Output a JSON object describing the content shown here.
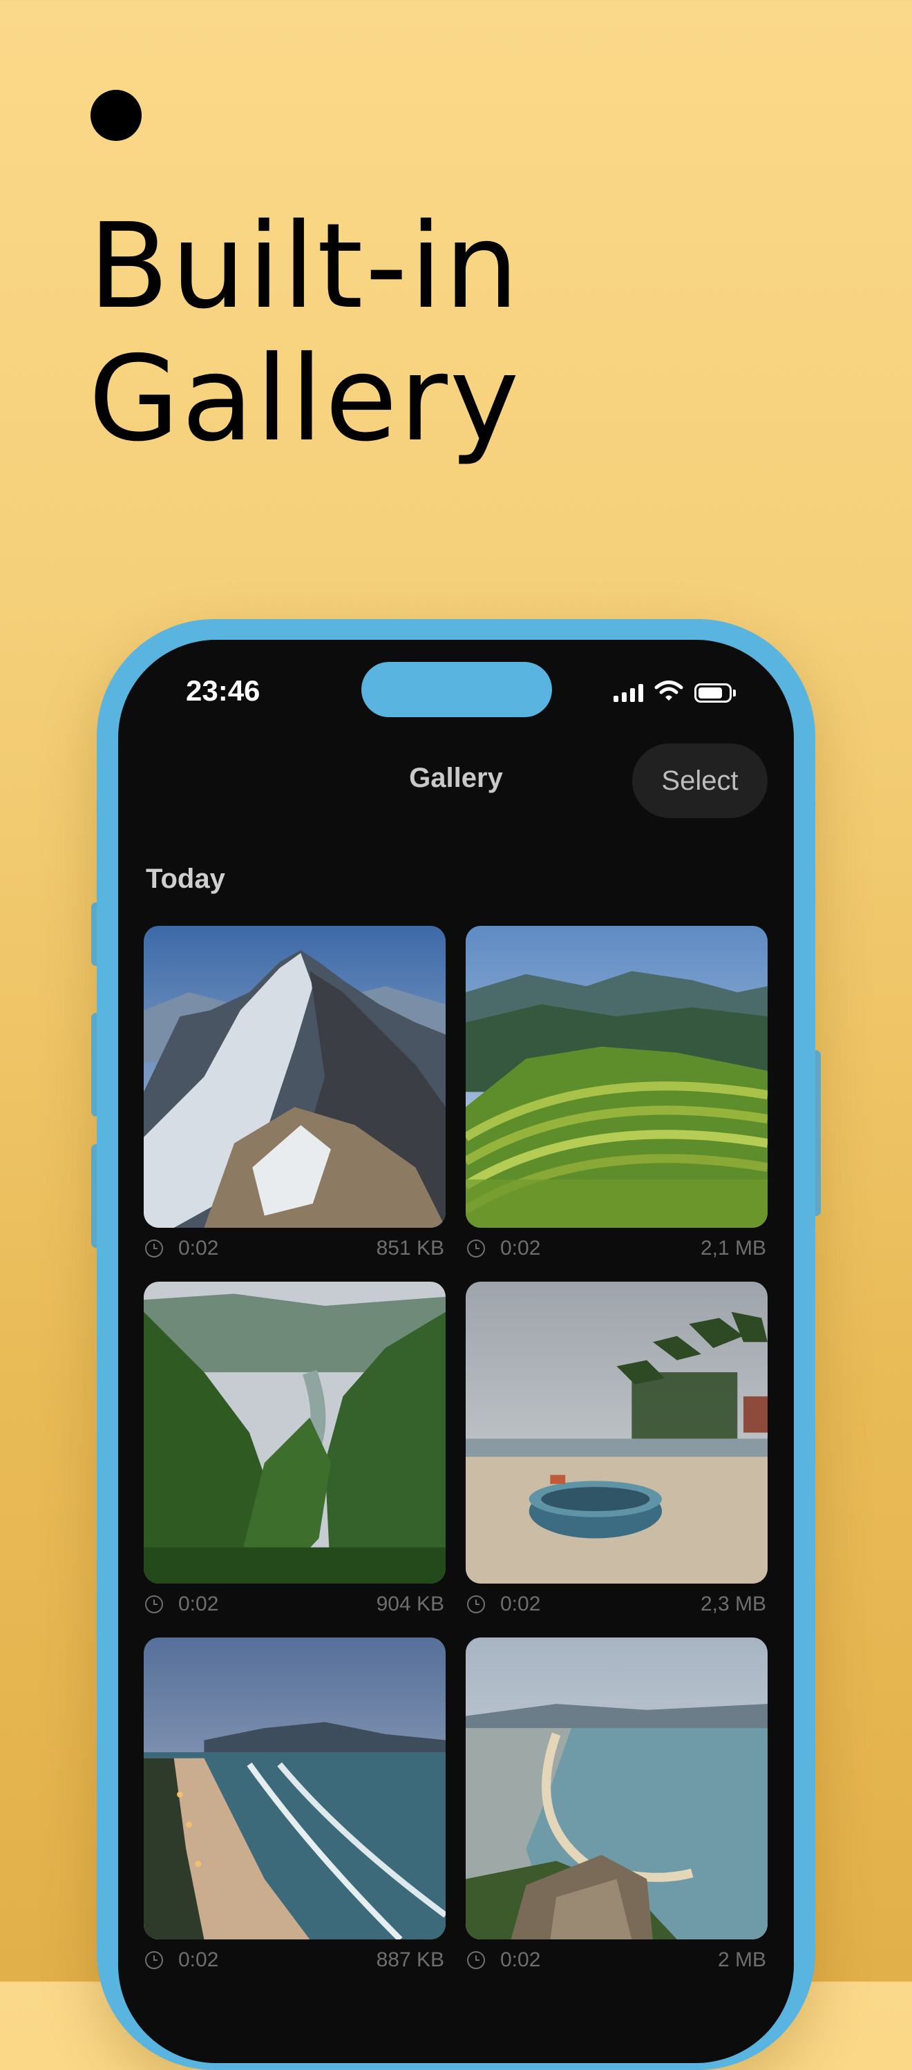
{
  "headline": {
    "line1": "Built-in",
    "line2": "Gallery"
  },
  "status_bar": {
    "time": "23:46"
  },
  "nav": {
    "title": "Gallery",
    "select_label": "Select"
  },
  "section": {
    "title": "Today"
  },
  "items": [
    {
      "duration": "0:02",
      "size": "851 KB",
      "icon": "clock-icon"
    },
    {
      "duration": "0:02",
      "size": "2,1 MB",
      "icon": "clock-icon"
    },
    {
      "duration": "0:02",
      "size": "904 KB",
      "icon": "clock-icon"
    },
    {
      "duration": "0:02",
      "size": "2,3 MB",
      "icon": "clock-icon"
    },
    {
      "duration": "0:02",
      "size": "887 KB",
      "icon": "clock-icon"
    },
    {
      "duration": "0:02",
      "size": "2 MB",
      "icon": "clock-icon"
    }
  ],
  "colors": {
    "background": "#f5d07a",
    "phone_frame": "#5ab4e0",
    "screen": "#0c0c0c"
  }
}
